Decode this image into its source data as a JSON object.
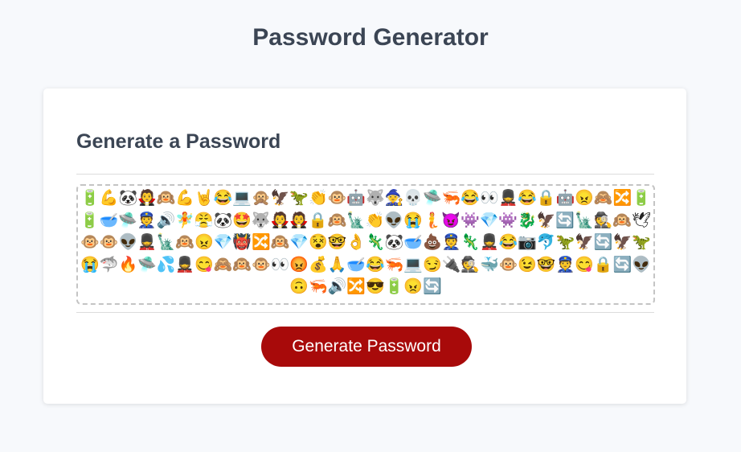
{
  "page_title": "Password Generator",
  "card": {
    "heading": "Generate a Password",
    "password": "🔋💪🐼🧛🙉💪🤘😂💻🙊🦅🦖👏🐵🤖🐺🧙💀🛸🦐😂👀💂😂🔒🤖😠🙈🔀🔋🔋🥣🛸👮🔊🧚😤🐼🤩🐺🧛🧛🔒🙉🗽👏👽😭🧜😈👾💎👾🐉🦅🔄🗽🕵🙉🕊🐵🐵👽💂🗽🙉😠💎👹🔀🙉💎😵🤓👌🦎🐼🥣💩👮🦎💂😂📷🐬🦖🦅🔄🦅🦖😭🦈🔥🛸💦💂😋🙈🙉🐵👀😡💰🙏🥣😂🦐💻😏🔌🕵🐳🐵😉🤓👮😋🔒🔄👽🙃🦐🔊🔀😎🔋😠🔄",
    "button_label": "Generate Password"
  },
  "colors": {
    "button": "#a80a0a",
    "heading": "#3b4554"
  }
}
